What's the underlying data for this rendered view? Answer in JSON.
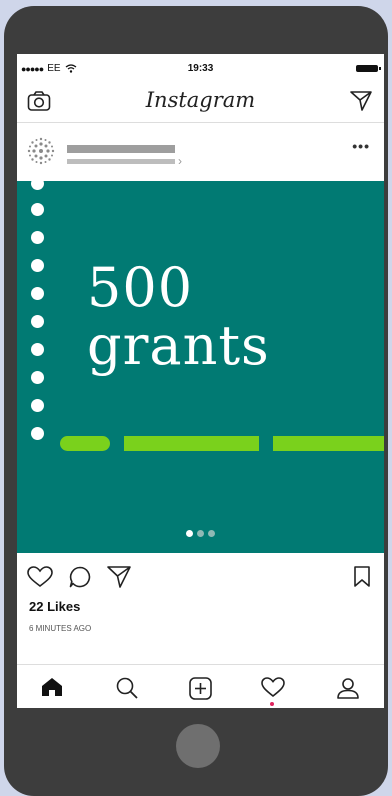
{
  "status_bar": {
    "carrier": "EE",
    "time": "19:33"
  },
  "nav": {
    "title": "Instagram"
  },
  "post": {
    "headline_line1": "500",
    "headline_line2": "grants",
    "carousel_pages": 3,
    "carousel_active": 1
  },
  "engagement": {
    "likes": "22 Likes",
    "timestamp": "6 MINUTES AGO"
  },
  "colors": {
    "post_background": "#017a73",
    "dash": "#7ad11c",
    "phone_body": "#3d3d3d",
    "page_background": "#cfd6ea"
  },
  "icons": {
    "nav": [
      "camera-icon",
      "direct-message-icon"
    ],
    "post_header": [
      "avatar",
      "more-options-icon"
    ],
    "actions": [
      "heart-icon",
      "comment-icon",
      "share-icon",
      "bookmark-icon"
    ],
    "tabbar": [
      "home-icon",
      "search-icon",
      "add-post-icon",
      "activity-icon",
      "profile-icon"
    ]
  }
}
